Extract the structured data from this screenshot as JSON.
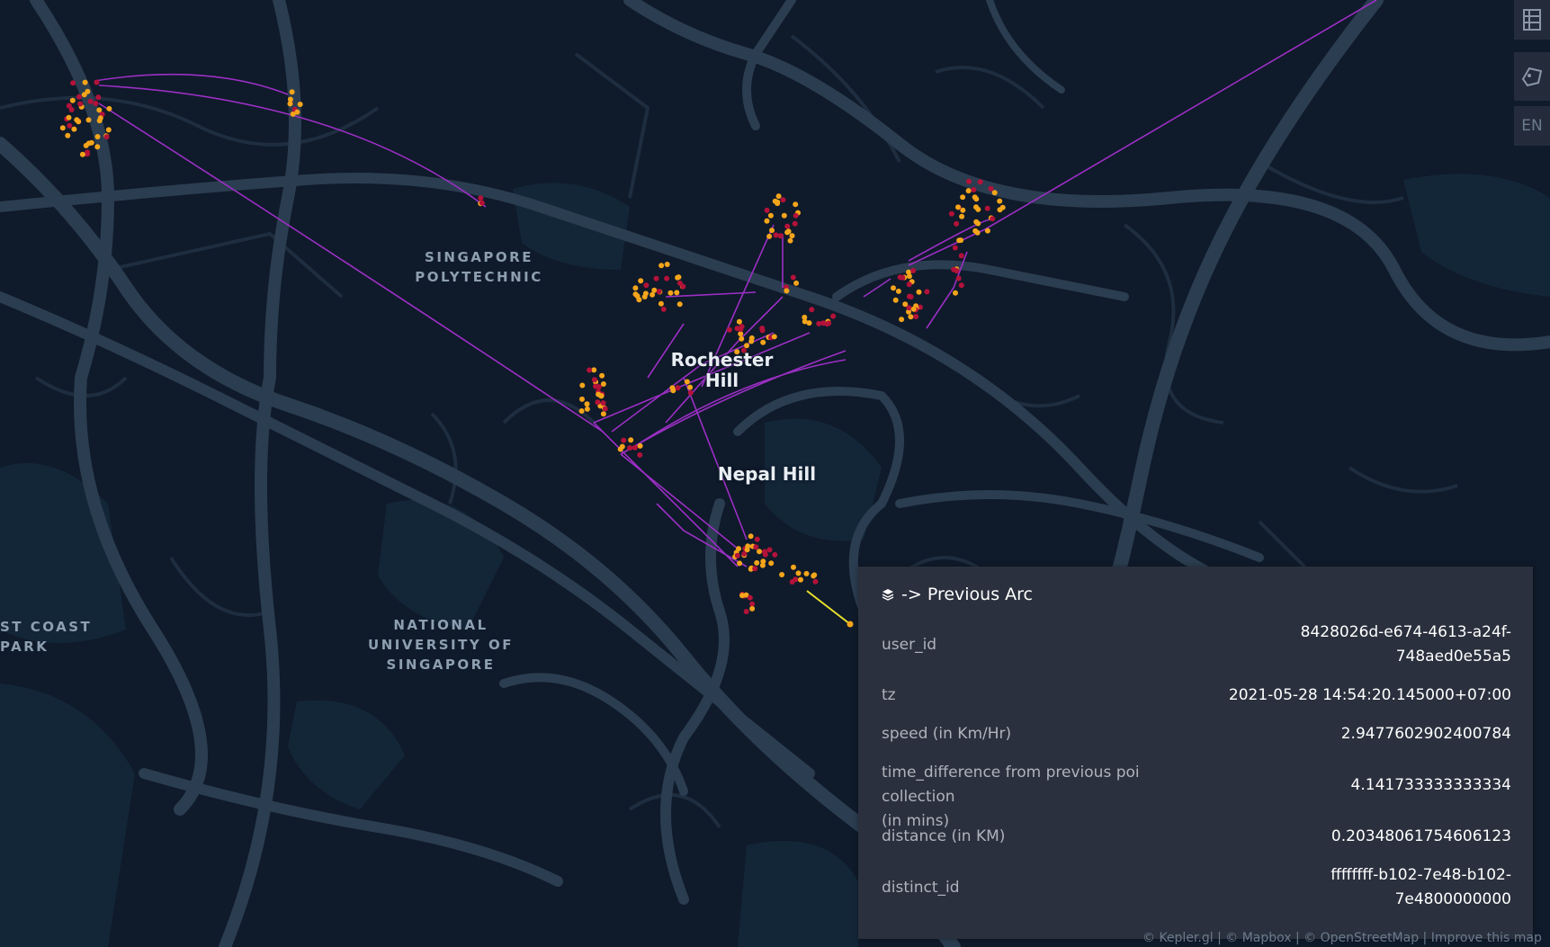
{
  "map": {
    "places": [
      {
        "id": "singapore-polytechnic",
        "text": "SINGAPORE\nPOLYTECHNIC"
      },
      {
        "id": "national-university",
        "text": "NATIONAL\nUNIVERSITY OF\nSINGAPORE"
      },
      {
        "id": "east-coast-park",
        "text": "ST COAST\nPARK"
      }
    ],
    "hills": [
      {
        "id": "rochester-hill",
        "text": "Rochester\nHill"
      },
      {
        "id": "nepal-hill",
        "text": "Nepal Hill"
      }
    ],
    "colors": {
      "background": "#0f1a2a",
      "road": "#2b3d50",
      "park": "#14283a",
      "arc": "#9b2fc4",
      "point_outer": "#f4a51b",
      "point_inner": "#b3123a",
      "hover_arc": "#e8e12c"
    }
  },
  "side_controls": {
    "table_icon": "table-icon",
    "draw_icon": "draw-polygon-icon",
    "locale_label": "EN"
  },
  "tooltip": {
    "layer_icon": "layers-icon",
    "title": "-> Previous Arc",
    "rows": [
      {
        "key": "user_id",
        "value": "8428026d-e674-4613-a24f-\n748aed0e55a5"
      },
      {
        "key": "tz",
        "value": "2021-05-28 14:54:20.145000+07:00"
      },
      {
        "key": "speed (in Km/Hr)",
        "value": "2.9477602902400784"
      },
      {
        "key": "time_difference from previous poi collection\n(in mins)",
        "value": "4.141733333333334"
      },
      {
        "key": "distance (in KM)",
        "value": "0.20348061754606123"
      },
      {
        "key": "distinct_id",
        "value": "ffffffff-b102-7e48-b102-\n7e4800000000"
      }
    ]
  },
  "attribution": "© Kepler.gl | © Mapbox | © OpenStreetMap | Improve this map"
}
